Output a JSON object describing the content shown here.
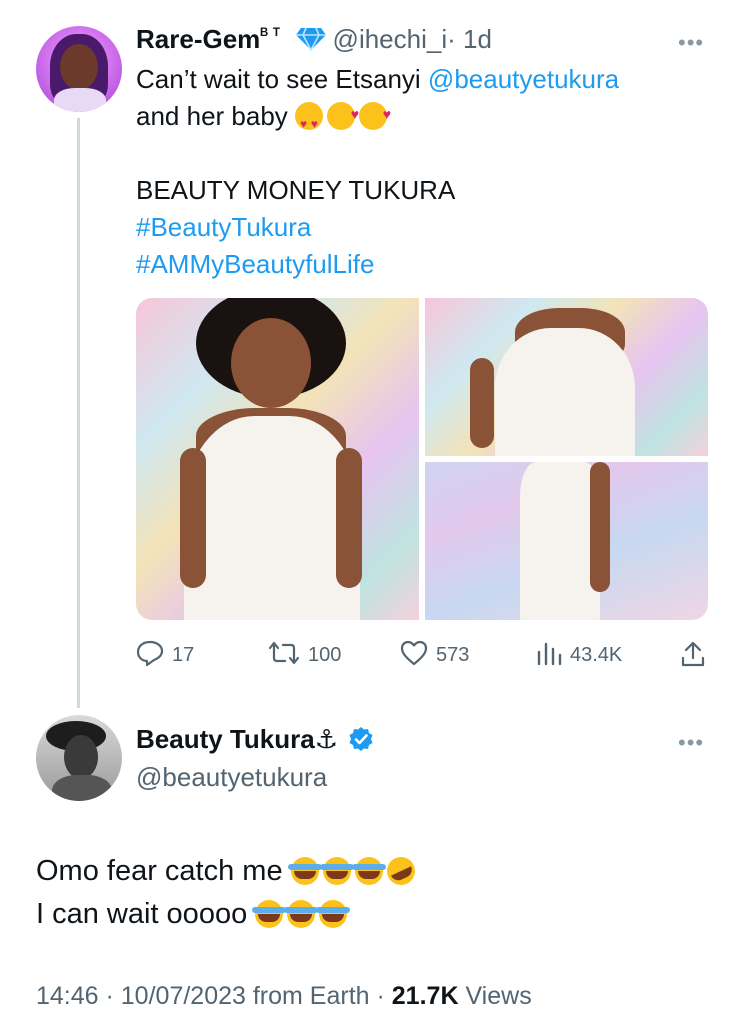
{
  "tweet1": {
    "display_name": "Rare-Gem",
    "name_suffix": "ᴮ ᵀ",
    "handle": "@ihechi_i",
    "time": "· 1d",
    "more": "•••",
    "line1_text": "Can’t wait to see Etsanyi ",
    "line1_mention": "@beautyetukura",
    "line2_text": "and her baby",
    "line3": "BEAUTY MONEY TUKURA",
    "hashtag1": "#BeautyTukura",
    "hashtag2": "#AMMyBeautyfulLife",
    "emojis": [
      "heart-eyes",
      "smiling-face-with-hearts",
      "smiling-face-with-hearts"
    ],
    "actions": {
      "replies": "17",
      "retweets": "100",
      "likes": "573",
      "views": "43.4K"
    }
  },
  "tweet2": {
    "display_name": "Beauty Tukura",
    "name_symbol": "⚓",
    "handle": "@beautyetukura",
    "more": "•••",
    "line1": "Omo fear catch me",
    "line2": "I can wait ooooo",
    "emojis_line1": [
      "face-with-tears-of-joy",
      "face-with-tears-of-joy",
      "face-with-tears-of-joy",
      "rolling-on-floor-laughing"
    ],
    "emojis_line2": [
      "face-with-tears-of-joy",
      "face-with-tears-of-joy",
      "face-with-tears-of-joy"
    ],
    "time": "14:46",
    "date": "10/07/2023",
    "source": "from Earth",
    "views_count": "21.7K",
    "views_label": "Views"
  },
  "colors": {
    "link": "#1d9bf0",
    "verified_badge": "#1d9bf0",
    "diamond": "#1d9bf0",
    "muted": "#536471"
  }
}
